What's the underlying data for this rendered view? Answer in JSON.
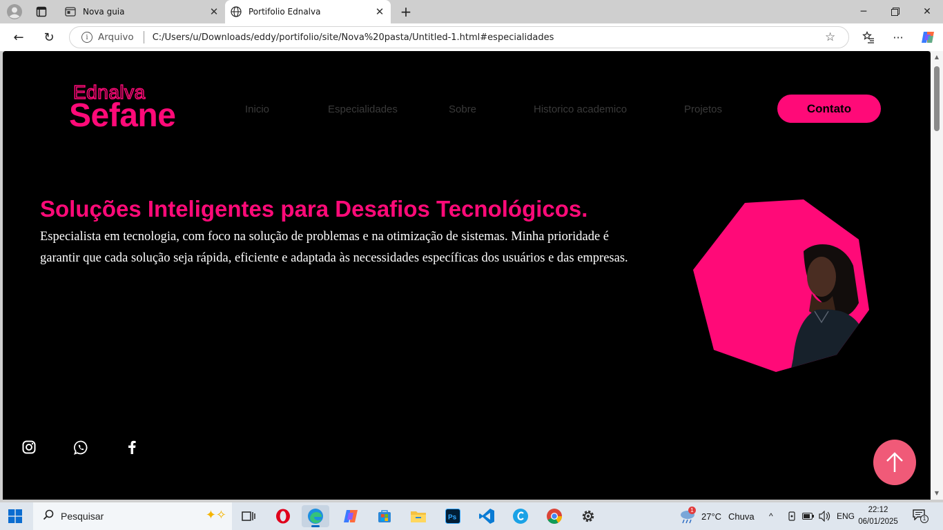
{
  "browser": {
    "tabs": [
      {
        "title": "Nova guia",
        "active": false,
        "icon": "new-tab-page-icon"
      },
      {
        "title": "Portifolio Ednalva",
        "active": true,
        "icon": "globe-icon"
      }
    ],
    "address": {
      "scheme_label": "Arquivo",
      "url": "C:/Users/u/Downloads/eddy/portifolio/site/Nova%20pasta/Untitled-1.html#especialidades"
    }
  },
  "page": {
    "logo_top": "Ednalva",
    "logo_bottom": "Sefane",
    "nav": [
      "Inicio",
      "Especialidades",
      "Sobre",
      "Historico academico",
      "Projetos"
    ],
    "cta_label": "Contato",
    "headline": "Soluções Inteligentes para Desafios Tecnológicos.",
    "description_line1": "Especialista em tecnologia, com foco na solução de problemas e na otimização de sistemas. Minha prioridade é",
    "description_line2": "garantir que cada solução seja rápida, eficiente e adaptada às necessidades específicas dos usuários e das empresas.",
    "social": [
      "instagram-icon",
      "whatsapp-icon",
      "facebook-icon"
    ],
    "colors": {
      "accent": "#ff0a78",
      "background": "#000000",
      "to_top": "#f05a78"
    }
  },
  "taskbar": {
    "search_placeholder": "Pesquisar",
    "weather_temp": "27°C",
    "weather_desc": "Chuva",
    "weather_badge": "1",
    "language": "ENG",
    "time": "22:12",
    "date": "06/01/2025",
    "notification_count": "1"
  }
}
